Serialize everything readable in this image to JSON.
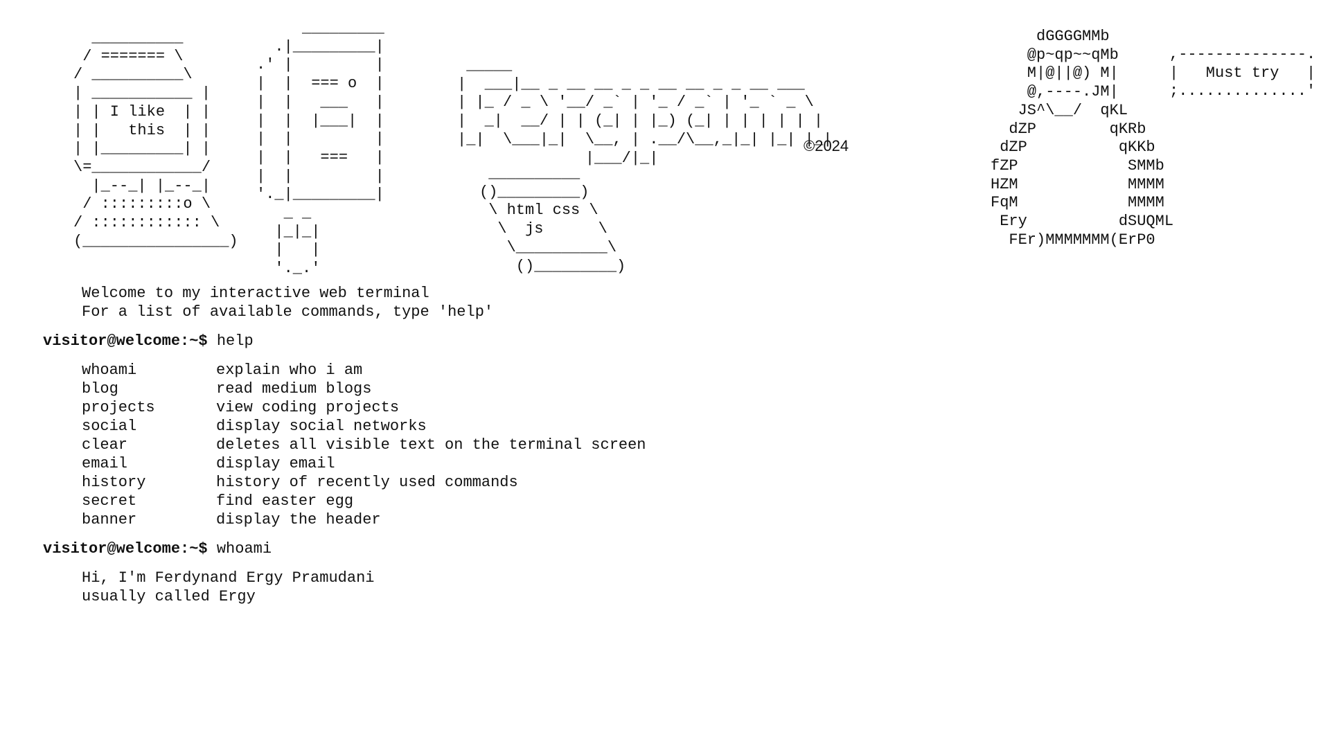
{
  "header": {
    "computer_art": "  __________\n / ======= \\\n/ __________\\\n| ___________ |\n| | I like  | |\n| |   this  | |\n| |_________| |\n\\=____________/\n  |_--_| |_--_|\n / :::::::::o \\\n/ :::::::::::: \\\n(________________)",
    "phone_art": "     _________\n  .|_________|\n.' |         |\n|  |  === o  |\n|  |   ___   |\n|  |  |___|  |\n|  |         |\n|  |   ===   |\n|  |         |\n'._|_________|\n   _ _\n  |_|_|\n  |   |\n  '._.'",
    "logo_art": " _____\n|  ___|__ _ __ __ _ _ __ __ _ _ __ ___ \n| |_ / _ \\ '__/ _` | '_ / _` | '_ ` _ \\\n|  _|  __/ | | (_| | |_) (_| | | | | | |\n|_|  \\___|_|  \\__, | .__/\\__,_|_| |_| |_|\n              |___/|_|",
    "copyright": "©2024",
    "screen_art": " __________\n()_________)\n \\ html css \\\n  \\  js      \\\n   \\__________\\\n    ()_________)",
    "character_art": "     dGGGGMMb\n    @p~qp~~qMb\n    M|@||@) M|\n    @,----.JM|\n   JS^\\__/  qKL\n  dZP        qKRb\n dZP          qKKb\nfZP            SMMb\nHZM            MMMM\nFqM            MMMM\n Ery          dSUQML\n  FEr)MMMMMMM(ErP0",
    "sign_art": ",--------------.\n|   Must try   |\n;..............'"
  },
  "welcome": {
    "line1": "Welcome to my interactive web terminal",
    "line2": "For a list of available commands, type 'help'"
  },
  "prompt": "visitor@welcome:~$",
  "session": [
    {
      "command": "help",
      "help_rows": [
        {
          "cmd": "whoami",
          "desc": "explain who i am"
        },
        {
          "cmd": "blog",
          "desc": "read medium blogs"
        },
        {
          "cmd": "projects",
          "desc": "view coding projects"
        },
        {
          "cmd": "social",
          "desc": "display social networks"
        },
        {
          "cmd": "clear",
          "desc": "deletes all visible text on the terminal screen"
        },
        {
          "cmd": "email",
          "desc": "display email"
        },
        {
          "cmd": "history",
          "desc": "history of recently used commands"
        },
        {
          "cmd": "secret",
          "desc": "find easter egg"
        },
        {
          "cmd": "banner",
          "desc": "display the header"
        }
      ]
    },
    {
      "command": "whoami",
      "output": [
        "Hi, I'm Ferdynand Ergy Pramudani",
        "usually called Ergy"
      ]
    }
  ]
}
